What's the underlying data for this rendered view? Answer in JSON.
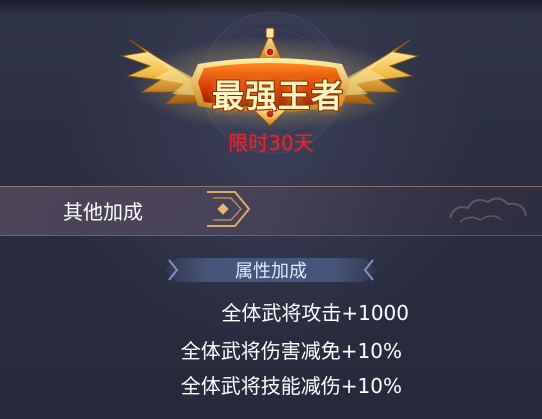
{
  "badge": {
    "title": "最强王者",
    "icon": "winged-crown-icon"
  },
  "duration": {
    "label": "限时30天"
  },
  "section": {
    "label": "其他加成"
  },
  "attributes": {
    "header": "属性加成",
    "items": [
      "全体武将攻击+1000",
      "全体武将伤害减免+10%",
      "全体武将技能减伤+10%"
    ]
  },
  "colors": {
    "background": "#2b2f42",
    "gold": "#f5c040",
    "red_text": "#e8252c",
    "tab_blue": "#4a5b82"
  }
}
